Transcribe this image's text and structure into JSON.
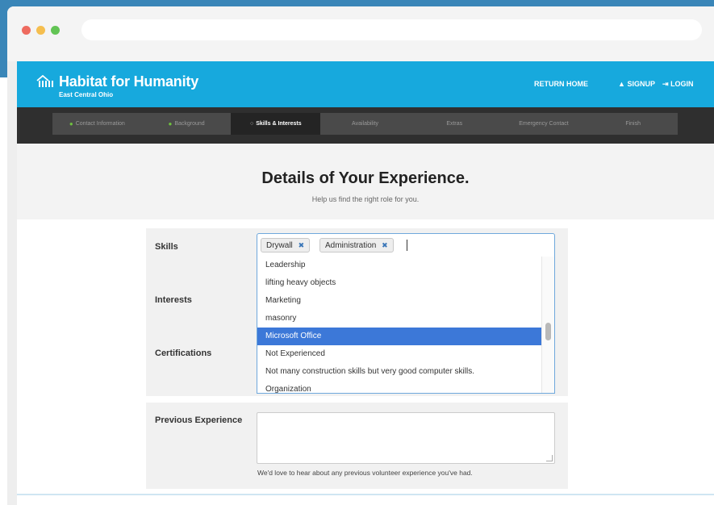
{
  "colors": {
    "header": "#17a9dd",
    "steps_bar": "#2f2f2f",
    "highlight": "#3c78d8",
    "check": "#6fc13f"
  },
  "site": {
    "name": "Habitat for Humanity",
    "subtitle": "East Central Ohio",
    "logo_icon": "house-people-icon"
  },
  "nav": {
    "return_home": "RETURN HOME",
    "signup": "SIGNUP",
    "signup_icon": "person-icon",
    "login": "LOGIN",
    "login_icon": "login-arrow-icon"
  },
  "steps": [
    {
      "label": "Contact Information",
      "state": "done"
    },
    {
      "label": "Background",
      "state": "done"
    },
    {
      "label": "Skills & Interests",
      "state": "active"
    },
    {
      "label": "Availability",
      "state": "todo"
    },
    {
      "label": "Extras",
      "state": "todo"
    },
    {
      "label": "Emergency Contact",
      "state": "todo"
    },
    {
      "label": "Finish",
      "state": "todo"
    }
  ],
  "hero": {
    "title": "Details of Your Experience.",
    "subtitle": "Help us find the right role for you."
  },
  "form": {
    "skills_label": "Skills",
    "interests_label": "Interests",
    "certifications_label": "Certifications",
    "previous_label": "Previous Experience",
    "selected_skills": [
      "Drywall",
      "Administration"
    ],
    "remove_glyph": "✖",
    "options": [
      "Leadership",
      "lifting heavy objects",
      "Marketing",
      "masonry",
      "Microsoft Office",
      "Not Experienced",
      "Not many construction skills but very good computer skills.",
      "Organization"
    ],
    "highlighted_option": "Microsoft Office",
    "previous_value": "",
    "previous_help": "We'd love to hear about any previous volunteer experience you've had."
  }
}
